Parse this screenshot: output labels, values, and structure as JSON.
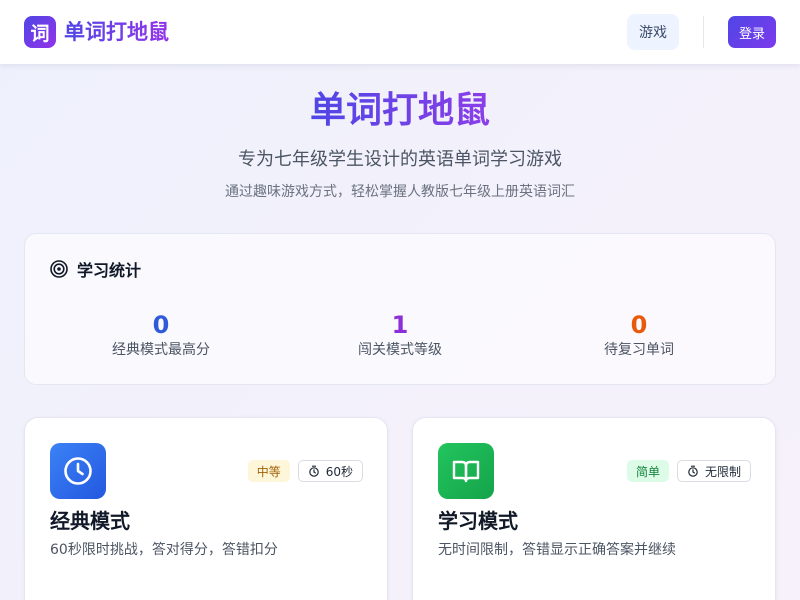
{
  "header": {
    "logo_char": "词",
    "app_title": "单词打地鼠",
    "nav_game": "游戏",
    "login": "登录"
  },
  "hero": {
    "title": "单词打地鼠",
    "subtitle": "专为七年级学生设计的英语单词学习游戏",
    "description": "通过趣味游戏方式，轻松掌握人教版七年级上册英语词汇"
  },
  "stats": {
    "title": "学习统计",
    "icon": "target-icon",
    "items": [
      {
        "value": "0",
        "label": "经典模式最高分",
        "color": "#2f5bd8"
      },
      {
        "value": "1",
        "label": "闯关模式等级",
        "color": "#8b2fd6"
      },
      {
        "value": "0",
        "label": "待复习单词",
        "color": "#e8590c"
      }
    ]
  },
  "modes": [
    {
      "title": "经典模式",
      "description": "60秒限时挑战，答对得分，答错扣分",
      "icon": "clock-icon",
      "icon_color": "#3b6ff0",
      "difficulty": "中等",
      "difficulty_bg": "#fef6d8",
      "difficulty_color": "#a16207",
      "time": "60秒"
    },
    {
      "title": "学习模式",
      "description": "无时间限制，答错显示正确答案并继续",
      "icon": "book-icon",
      "icon_color": "#16a34a",
      "difficulty": "简单",
      "difficulty_bg": "#dcfce7",
      "difficulty_color": "#15803d",
      "time": "无限制"
    }
  ]
}
